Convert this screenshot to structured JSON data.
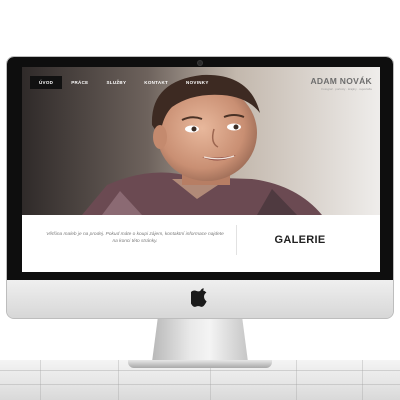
{
  "website": {
    "nav": [
      {
        "label": "Úvod",
        "active": true
      },
      {
        "label": "Práce",
        "active": false
      },
      {
        "label": "Služby",
        "active": false
      },
      {
        "label": "Kontakt",
        "active": false
      },
      {
        "label": "Novinky",
        "active": false
      }
    ],
    "brand": {
      "name": "ADAM NOVÁK",
      "subtitle": "Fotograf · portréty · krajiny · reportáže"
    },
    "intro_text": "Většina maleb je na prodej. Pokud máte o koupi zájem, kontaktní informace najdete na konci této stránky.",
    "section_title": "GALERIE"
  },
  "colors": {
    "nav_active_bg": "#111111",
    "brand_text": "#6d6d6d",
    "section_title": "#222222"
  },
  "icons": {
    "logo": "apple-logo-icon",
    "camera": "webcam-icon"
  }
}
